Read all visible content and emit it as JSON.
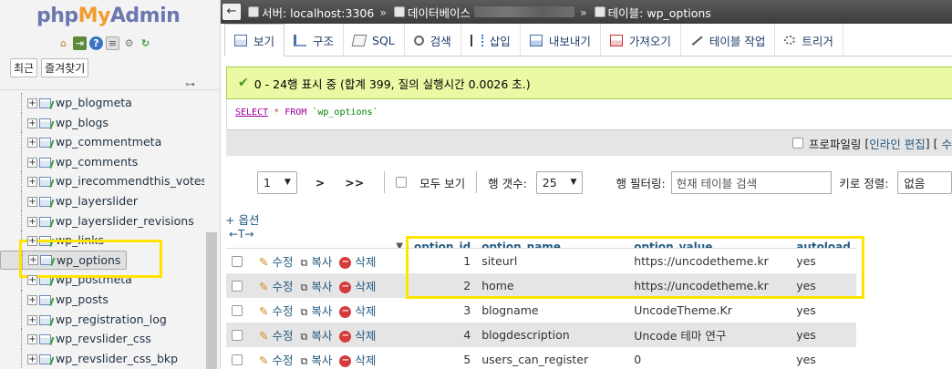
{
  "nav": {
    "logo": {
      "php": "php",
      "my": "My",
      "admin": "Admin"
    },
    "icons": [
      "home-icon",
      "exit-icon",
      "help-icon",
      "docs-icon",
      "settings-icon",
      "reload-icon"
    ],
    "tabs": [
      "최근",
      "즐겨찾기"
    ],
    "tables": [
      {
        "name": "wp_blogmeta"
      },
      {
        "name": "wp_blogs"
      },
      {
        "name": "wp_commentmeta"
      },
      {
        "name": "wp_comments"
      },
      {
        "name": "wp_irecommendthis_votes"
      },
      {
        "name": "wp_layerslider"
      },
      {
        "name": "wp_layerslider_revisions"
      },
      {
        "name": "wp_links"
      },
      {
        "name": "wp_options",
        "selected": true
      },
      {
        "name": "wp_postmeta"
      },
      {
        "name": "wp_posts"
      },
      {
        "name": "wp_registration_log"
      },
      {
        "name": "wp_revslider_css"
      },
      {
        "name": "wp_revslider_css_bkp"
      }
    ]
  },
  "breadcrumb": {
    "server": "서버: localhost:3306",
    "database": "데이터베이스",
    "table": "테이블: wp_options",
    "sep": "»"
  },
  "tabs": [
    {
      "label": "보기",
      "icon": "browse-icon",
      "active": true
    },
    {
      "label": "구조",
      "icon": "structure-icon"
    },
    {
      "label": "SQL",
      "icon": "sql-icon"
    },
    {
      "label": "검색",
      "icon": "search-icon"
    },
    {
      "label": "삽입",
      "icon": "insert-icon"
    },
    {
      "label": "내보내기",
      "icon": "export-icon"
    },
    {
      "label": "가져오기",
      "icon": "import-icon"
    },
    {
      "label": "테이블 작업",
      "icon": "operations-icon"
    },
    {
      "label": "트리거",
      "icon": "triggers-icon"
    }
  ],
  "notice": {
    "text": "0 - 24행 표시 중 (합계 399, 질의 실행시간 0.0026 초.)"
  },
  "sql": {
    "select": "SELECT",
    "star": "*",
    "from": "FROM",
    "table": "`wp_options`"
  },
  "profiling": {
    "label": "프로파일링",
    "bracket_open": "[",
    "inline_edit": "인라인 편집",
    "bracket_close": "] [",
    "more": "수"
  },
  "pager": {
    "page": "1",
    "next": ">",
    "last": ">>",
    "show_all": "모두 보기",
    "rows_label": "행 갯수:",
    "rows_value": "25",
    "filter_label": "행 필터링:",
    "filter_placeholder": "현재 테이블 검색",
    "sort_label": "키로 정렬:",
    "sort_value": "없음"
  },
  "options_link": "+ 옵션",
  "resize_arrows": "←T→",
  "table": {
    "columns": [
      "option_id",
      "option_name",
      "option_value",
      "autoload"
    ],
    "actions": {
      "edit": "수정",
      "copy": "복사",
      "delete": "삭제"
    },
    "rows": [
      {
        "id": "1",
        "name": "siteurl",
        "value": "https://uncodetheme.kr",
        "autoload": "yes"
      },
      {
        "id": "2",
        "name": "home",
        "value": "https://uncodetheme.kr",
        "autoload": "yes"
      },
      {
        "id": "3",
        "name": "blogname",
        "value": "UncodeTheme.Kr",
        "autoload": "yes"
      },
      {
        "id": "4",
        "name": "blogdescription",
        "value": "Uncode 테마 연구",
        "autoload": "yes"
      },
      {
        "id": "5",
        "name": "users_can_register",
        "value": "0",
        "autoload": "yes"
      }
    ]
  },
  "colors": {
    "notice_bg": "#ebf8a4",
    "highlight": "#ffe400",
    "link": "#235a81",
    "topbar": "#4a4a4a"
  }
}
